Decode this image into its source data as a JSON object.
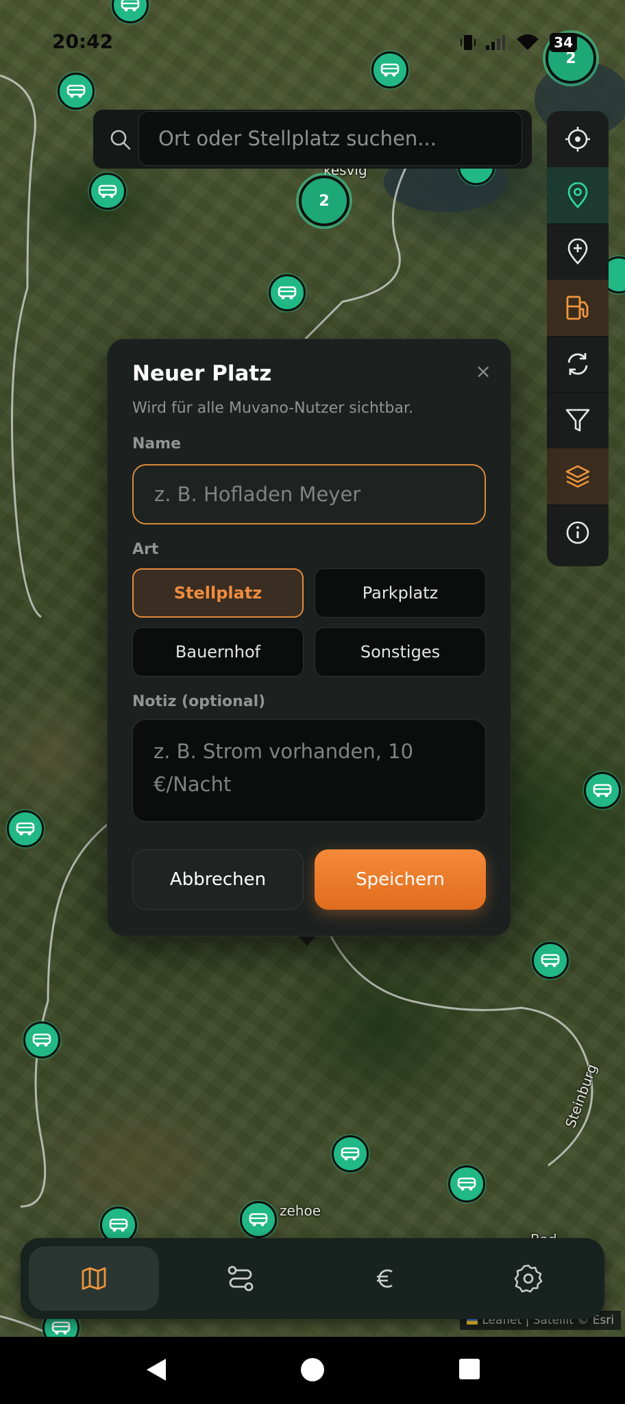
{
  "status_bar": {
    "time": "20:42",
    "battery": "34"
  },
  "map": {
    "labels": {
      "a": "zehoe",
      "b": "Steinburg",
      "c": "Bad Bramsted",
      "d": "kesvig"
    },
    "clusters": [
      "2",
      "2"
    ]
  },
  "search": {
    "placeholder": "Ort oder Stellplatz suchen..."
  },
  "toolbar": {
    "items": [
      "locate-icon",
      "map-pin-icon",
      "add-pin-icon",
      "fuel-icon",
      "refresh-icon",
      "filter-icon",
      "layers-icon",
      "info-icon"
    ]
  },
  "modal": {
    "title": "Neuer Platz",
    "close": "×",
    "subtitle": "Wird für alle Muvano-Nutzer sichtbar.",
    "name_label": "Name",
    "name_placeholder": "z. B. Hofladen Meyer",
    "type_label": "Art",
    "types": [
      "Stellplatz",
      "Parkplatz",
      "Bauernhof",
      "Sonstiges"
    ],
    "selected_type": "Stellplatz",
    "note_label": "Notiz (optional)",
    "note_placeholder": "z. B. Strom vorhanden, 10 €/Nacht",
    "cancel": "Abbrechen",
    "save": "Speichern"
  },
  "bottom_nav": {
    "items": [
      "map-icon",
      "route-icon",
      "euro-icon",
      "settings-icon"
    ],
    "active": "map-icon"
  },
  "attribution": {
    "leaflet": "Leaflet",
    "sep": "|",
    "source": "Satellit © Esri"
  },
  "colors": {
    "accent": "#F08C3E",
    "marker": "#21B885",
    "panel": "#1C2120"
  }
}
